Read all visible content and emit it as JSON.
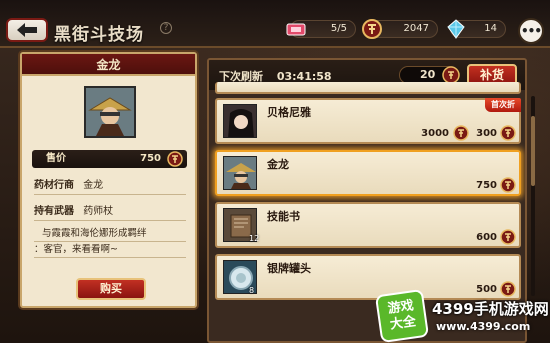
{
  "header": {
    "title": "黑街斗技场",
    "ticket": "5/5",
    "coins": "2047",
    "gems": "14"
  },
  "detail": {
    "name": "金龙",
    "price_label": "售价",
    "price": "750",
    "row1_label": "药材行商",
    "row1_value": "金龙",
    "row2_label": "持有武器",
    "row2_value": "药师杖",
    "desc_line1": "与霞霞和海伦娜形成羁绊",
    "desc_line2": "：客官，来看看啊~",
    "buy_label": "购买"
  },
  "shop": {
    "refresh_label": "下次刷新",
    "refresh_time": "03:41:58",
    "refresh_cost": "20",
    "refresh_button": "补货",
    "items": [
      {
        "name": "贝格尼雅",
        "old_price": "3000",
        "price": "300",
        "badge": "首次折"
      },
      {
        "name": "金龙",
        "price": "750"
      },
      {
        "name": "技能书",
        "price": "600",
        "qty": "12"
      },
      {
        "name": "银牌罐头",
        "price": "500",
        "qty": "8"
      }
    ]
  },
  "watermark": {
    "logo_text_1": "游戏",
    "logo_text_2": "大全",
    "site_name": "4399手机游戏网",
    "site_url": "www.4399.com"
  },
  "colors": {
    "accent_red": "#8e1510",
    "panel_cream": "#f2e7cf",
    "gold_border": "#c9a66b",
    "selected_glow": "#f0a020"
  }
}
